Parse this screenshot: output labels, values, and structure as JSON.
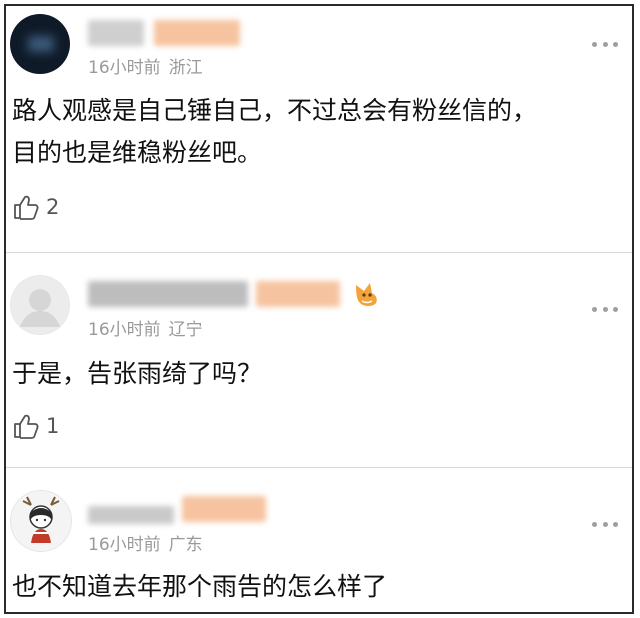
{
  "comments": [
    {
      "time": "16小时前",
      "location": "浙江",
      "text_lines": [
        "路人观感是自己锤自己，不过总会有粉丝信的，",
        "目的也是维稳粉丝吧。"
      ],
      "likes": "2"
    },
    {
      "time": "16小时前",
      "location": "辽宁",
      "text_lines": [
        "于是，告张雨绮了吗？"
      ],
      "likes": "1"
    },
    {
      "time": "16小时前",
      "location": "广东",
      "text_lines": [
        "也不知道去年那个雨告的怎么样了"
      ],
      "likes": ""
    }
  ],
  "icons": {
    "like": "thumbs-up-icon",
    "more": "more-dots-icon",
    "badge": "fox-badge-icon"
  },
  "colors": {
    "meta_text": "#9a9a9a",
    "body_text": "#111111",
    "divider": "#d9d9d9",
    "blur_accent": "#f6c3a0"
  }
}
